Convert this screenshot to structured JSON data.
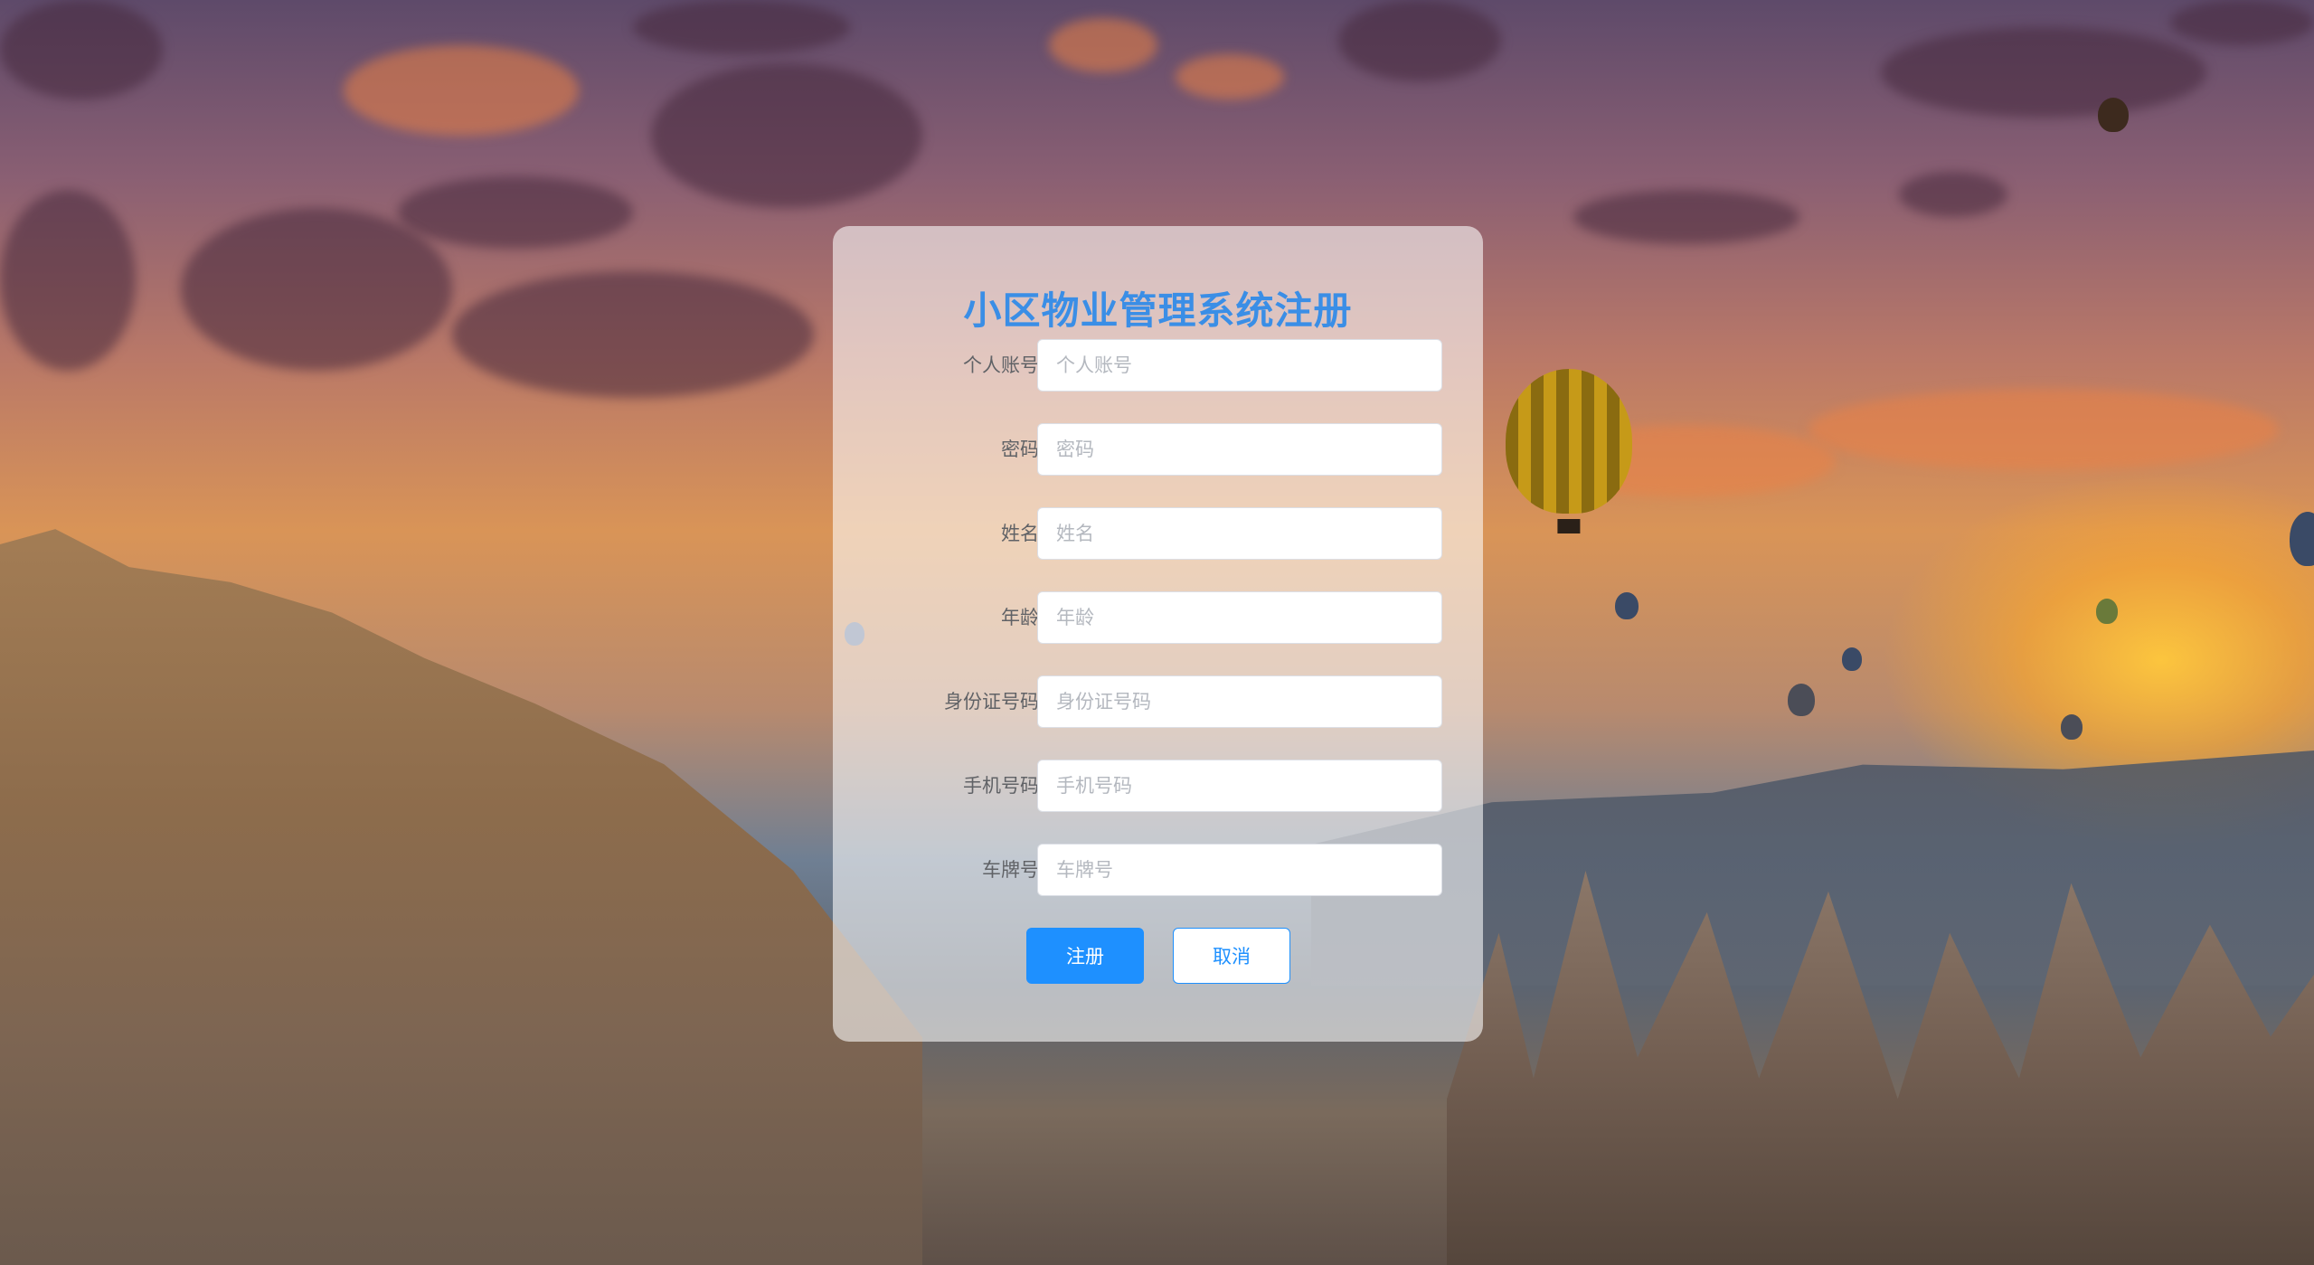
{
  "page": {
    "title": "小区物业管理系统注册"
  },
  "form": {
    "fields": [
      {
        "label": "个人账号",
        "placeholder": "个人账号",
        "value": ""
      },
      {
        "label": "密码",
        "placeholder": "密码",
        "value": ""
      },
      {
        "label": "姓名",
        "placeholder": "姓名",
        "value": ""
      },
      {
        "label": "年龄",
        "placeholder": "年龄",
        "value": ""
      },
      {
        "label": "身份证号码",
        "placeholder": "身份证号码",
        "value": ""
      },
      {
        "label": "手机号码",
        "placeholder": "手机号码",
        "value": ""
      },
      {
        "label": "车牌号",
        "placeholder": "车牌号",
        "value": ""
      }
    ],
    "submit_label": "注册",
    "cancel_label": "取消"
  },
  "colors": {
    "title": "#3a8ee6",
    "primary": "#1e90ff",
    "label": "#606266",
    "placeholder": "#b4b8bf"
  }
}
